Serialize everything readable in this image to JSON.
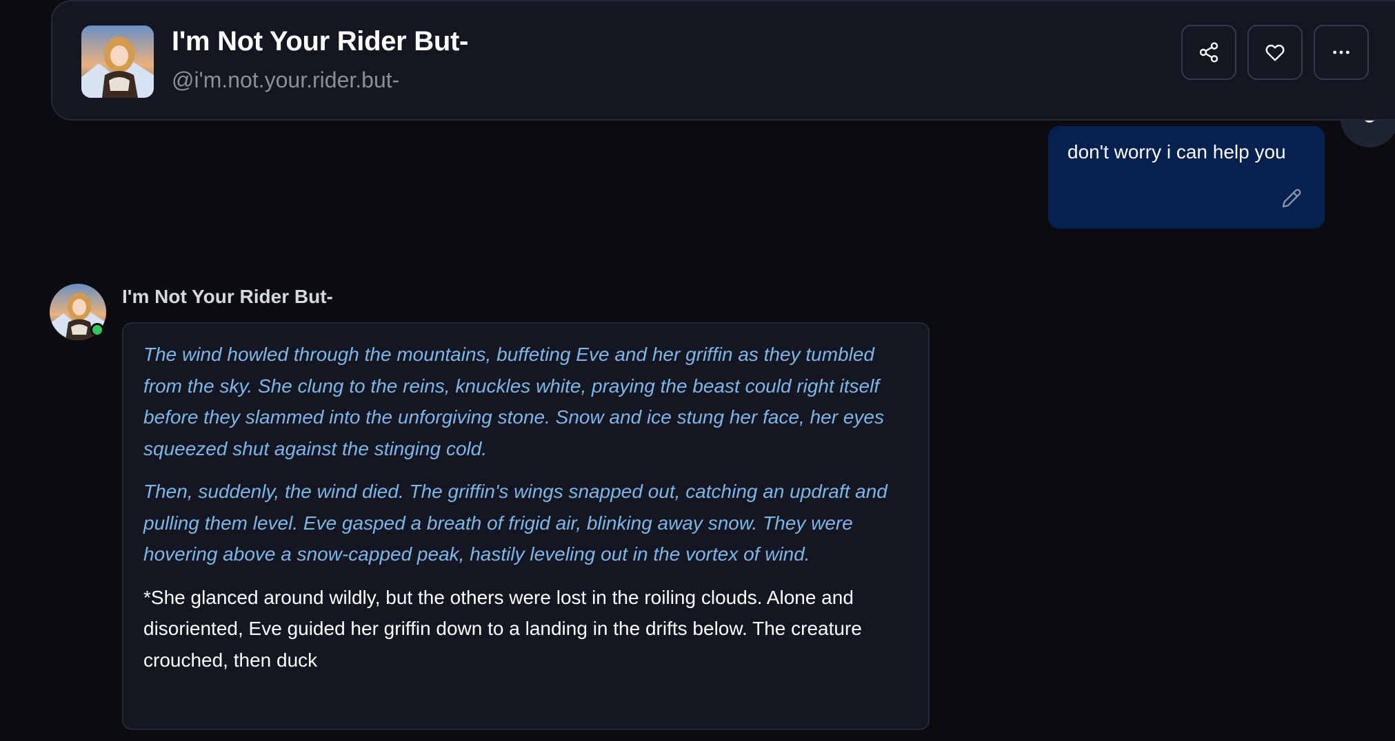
{
  "header": {
    "title": "I'm Not Your Rider But-",
    "handle": "@i'm.not.your.rider.but-",
    "buttons": {
      "share": "share-icon",
      "favorite": "heart-icon",
      "more": "more-icon"
    }
  },
  "conversation": {
    "user_message": {
      "text": "don't worry i can help you",
      "edit_icon": "pencil-icon"
    },
    "bot_message": {
      "name": "I'm Not Your Rider But-",
      "status": "online",
      "paragraphs": [
        "The wind howled through the mountains, buffeting Eve and her griffin as they tumbled from the sky. She clung to the reins, knuckles white, praying the beast could right itself before they slammed into the unforgiving stone. Snow and ice stung her face, her eyes squeezed shut against the stinging cold.",
        "Then, suddenly, the wind died. The griffin's wings snapped out, catching an updraft and pulling them level. Eve gasped a breath of frigid air, blinking away snow. They were hovering above a snow-capped peak, hastily leveling out in the vortex of wind.",
        "*She glanced around wildly, but the others were lost in the roiling clouds. Alone and disoriented, Eve guided her griffin down to a landing in the drifts below. The creature crouched, then duck"
      ]
    }
  },
  "colors": {
    "background": "#0b0c10",
    "panel": "#141722",
    "user_bubble": "#04214f",
    "narration_text": "#7db6e8",
    "online": "#34c759"
  }
}
